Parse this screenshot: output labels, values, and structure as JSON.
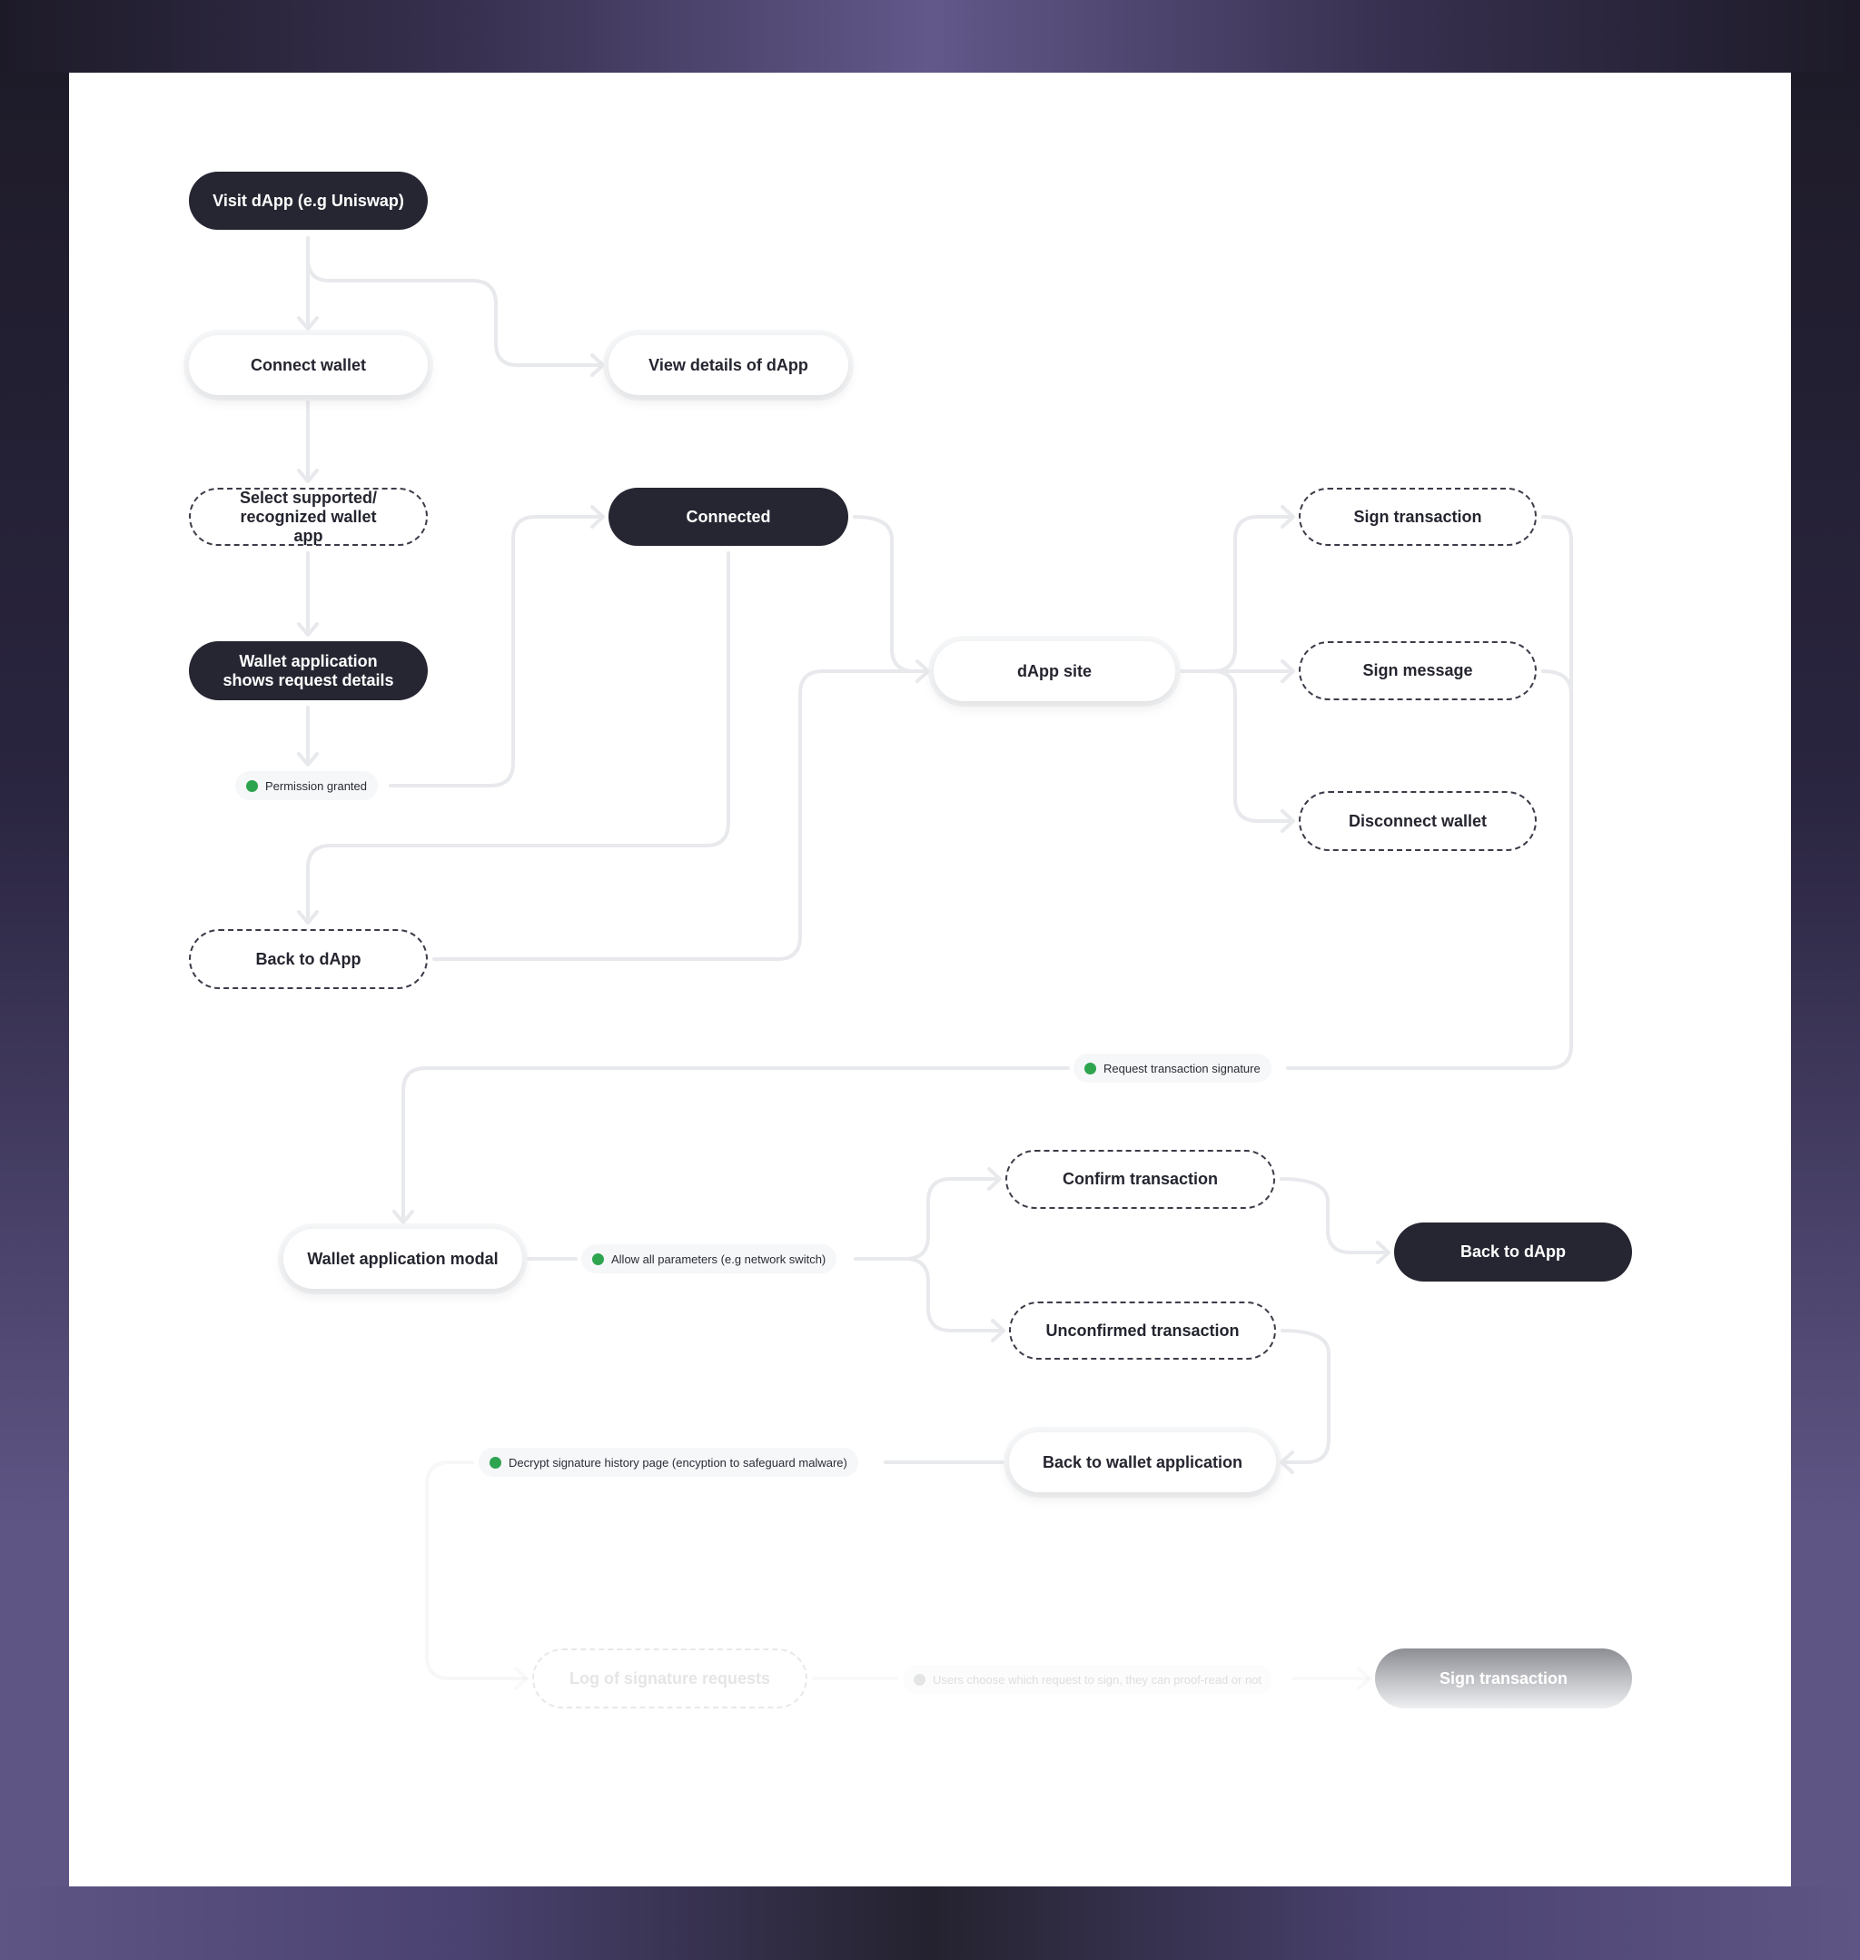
{
  "colors": {
    "dark_node": "#252631",
    "edge": "#e8e9ec",
    "status_dot": "#2ea44f",
    "background_purple": "#5f5585"
  },
  "nodes": {
    "visit_dapp": "Visit dApp (e.g Uniswap)",
    "connect_wallet": "Connect wallet",
    "view_details": "View details of dApp",
    "select_wallet": "Select supported/ recognized wallet app",
    "connected": "Connected",
    "wallet_shows": "Wallet application shows request details",
    "dapp_site": "dApp site",
    "sign_transaction": "Sign transaction",
    "sign_message": "Sign message",
    "disconnect_wallet": "Disconnect wallet",
    "back_to_dapp_1": "Back to dApp",
    "wallet_modal": "Wallet application modal",
    "confirm_transaction": "Confirm transaction",
    "back_to_dapp_2": "Back to dApp",
    "unconfirmed_transaction": "Unconfirmed transaction",
    "back_to_wallet": "Back to wallet application",
    "log_signature_requests": "Log of signature requests",
    "sign_transaction_final": "Sign transaction"
  },
  "labels": {
    "permission_granted": "Permission granted",
    "request_signature": "Request transaction signature",
    "allow_parameters": "Allow all parameters (e.g network switch)",
    "decrypt_history": "Decrypt signature history page (encyption to safeguard malware)",
    "users_choose": "Users choose which request to sign, they can proof-read or not"
  }
}
